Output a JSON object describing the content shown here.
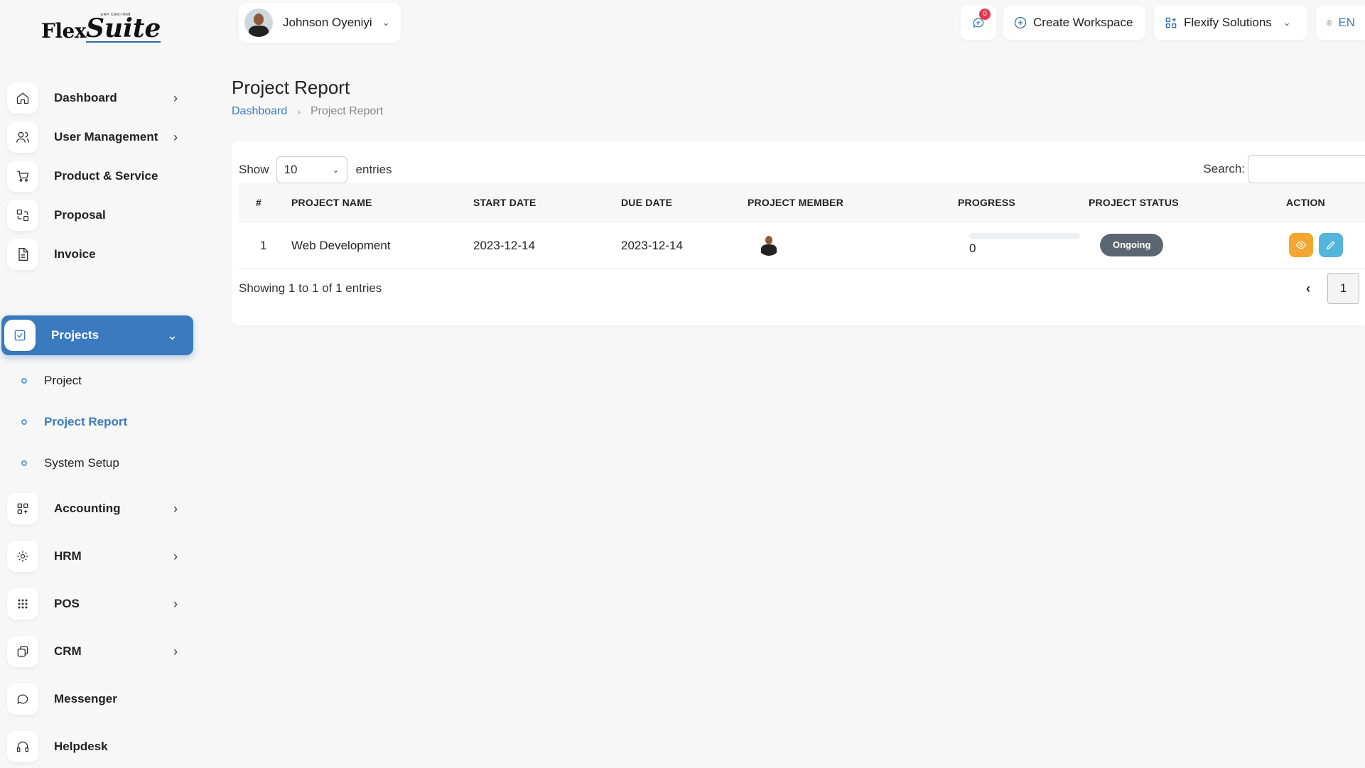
{
  "logo": {
    "text_a": "Flex",
    "text_b": "Suite",
    "tagline": "ERP·CRM·HRM"
  },
  "user": {
    "name": "Johnson Oyeniyi"
  },
  "header": {
    "messages_badge": "0",
    "create_workspace": "Create Workspace",
    "company": "Flexify Solutions",
    "language": "EN"
  },
  "sidebar": {
    "items": [
      {
        "label": "Dashboard",
        "icon": "home-icon"
      },
      {
        "label": "User Management",
        "icon": "users-icon"
      },
      {
        "label": "Product & Service",
        "icon": "cart-icon"
      },
      {
        "label": "Proposal",
        "icon": "proposal-icon"
      },
      {
        "label": "Invoice",
        "icon": "file-icon"
      },
      {
        "label": "Projects",
        "icon": "check-square-icon"
      },
      {
        "label": "Accounting",
        "icon": "grid-icon"
      },
      {
        "label": "HRM",
        "icon": "hrm-icon"
      },
      {
        "label": "POS",
        "icon": "dots-grid-icon"
      },
      {
        "label": "CRM",
        "icon": "crm-icon"
      },
      {
        "label": "Messenger",
        "icon": "chat-icon"
      },
      {
        "label": "Helpdesk",
        "icon": "headset-icon"
      }
    ],
    "sub_items": [
      {
        "label": "Project"
      },
      {
        "label": "Project Report"
      },
      {
        "label": "System Setup"
      }
    ]
  },
  "page": {
    "title": "Project Report",
    "breadcrumb_root": "Dashboard",
    "breadcrumb_current": "Project Report"
  },
  "table": {
    "show_label": "Show",
    "entries_value": "10",
    "entries_label": "entries",
    "search_label": "Search:",
    "columns": [
      "#",
      "PROJECT NAME",
      "START DATE",
      "DUE DATE",
      "PROJECT MEMBER",
      "PROGRESS",
      "PROJECT STATUS",
      "ACTION"
    ],
    "rows": [
      {
        "index": "1",
        "name": "Web Development",
        "start": "2023-12-14",
        "due": "2023-12-14",
        "progress": "0",
        "progress_fraction": 0,
        "status": "Ongoing"
      }
    ],
    "summary": "Showing 1 to 1 of 1 entries",
    "page": "1",
    "prev_symbol": "‹"
  },
  "colors": {
    "accent": "#3a7bbf",
    "status_badge": "#5c6670",
    "view_button": "#f4a532",
    "edit_button": "#53b5d9",
    "notification": "#e53950"
  }
}
